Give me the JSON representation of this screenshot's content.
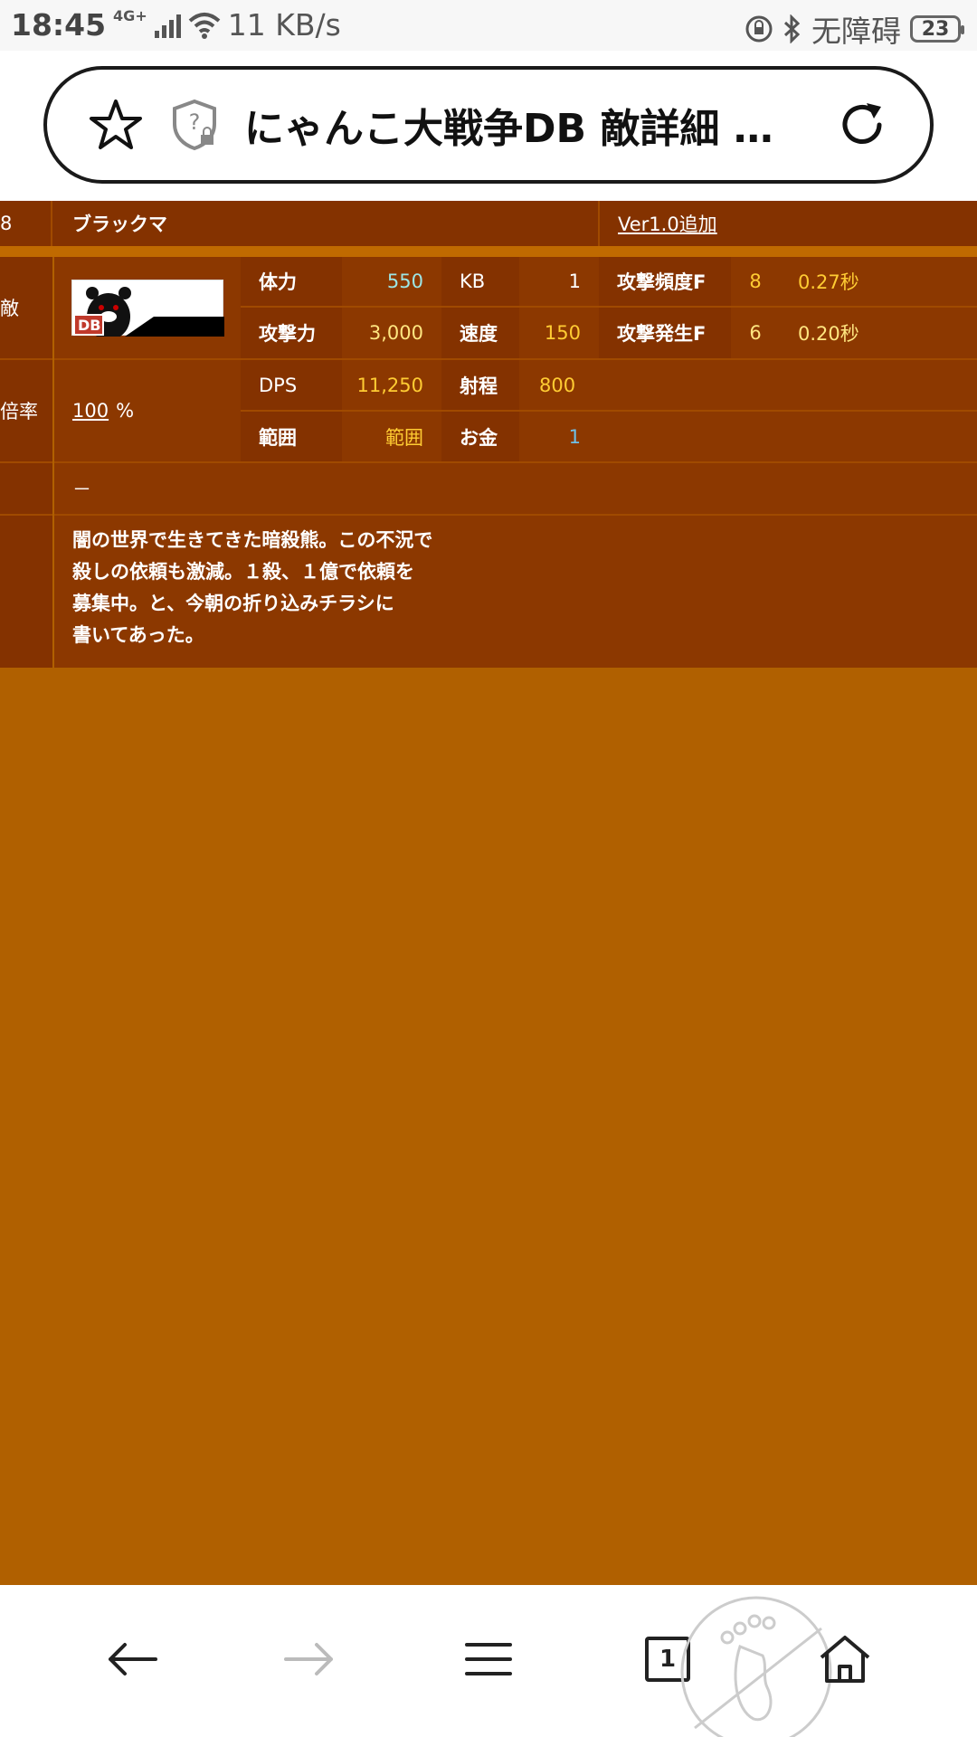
{
  "status_bar": {
    "time": "18:45",
    "network_type": "4G+",
    "speed": "11 KB/s",
    "accessibility": "无障碍",
    "battery": "23"
  },
  "address_bar": {
    "title": "にゃんこ大戦争DB 敵詳細 …"
  },
  "enemy": {
    "id": "8",
    "name": "ブラックマ",
    "version": "Ver1.0追加",
    "type_label": "敵",
    "icon_text": "DB",
    "magnification_label": "倍率",
    "magnification_value": "100",
    "magnification_unit": "%",
    "stats": {
      "hp_label": "体力",
      "hp_value": "550",
      "kb_label": "KB",
      "kb_value": "1",
      "attack_freq_label": "攻撃頻度F",
      "attack_freq_value": "8",
      "attack_freq_sec": "0.27秒",
      "attack_label": "攻撃力",
      "attack_value": "3,000",
      "speed_label": "速度",
      "speed_value": "150",
      "attack_occur_label": "攻撃発生F",
      "attack_occur_value": "6",
      "attack_occur_sec": "0.20秒",
      "dps_label": "DPS",
      "dps_value": "11,250",
      "range_label": "射程",
      "range_value": "800",
      "area_label": "範囲",
      "area_value": "範囲",
      "money_label": "お金",
      "money_value": "1"
    },
    "ability": "－",
    "description_lines": [
      "闇の世界で生きてきた暗殺熊。この不況で",
      "殺しの依頼も激減。１殺、１億で依頼を",
      "募集中。と、今朝の折り込みチラシに",
      "書いてあった。"
    ]
  },
  "bottom_nav": {
    "tab_count": "1",
    "icons": [
      "back-arrow-icon",
      "forward-arrow-icon",
      "menu-icon",
      "tabs-icon",
      "home-icon"
    ]
  }
}
